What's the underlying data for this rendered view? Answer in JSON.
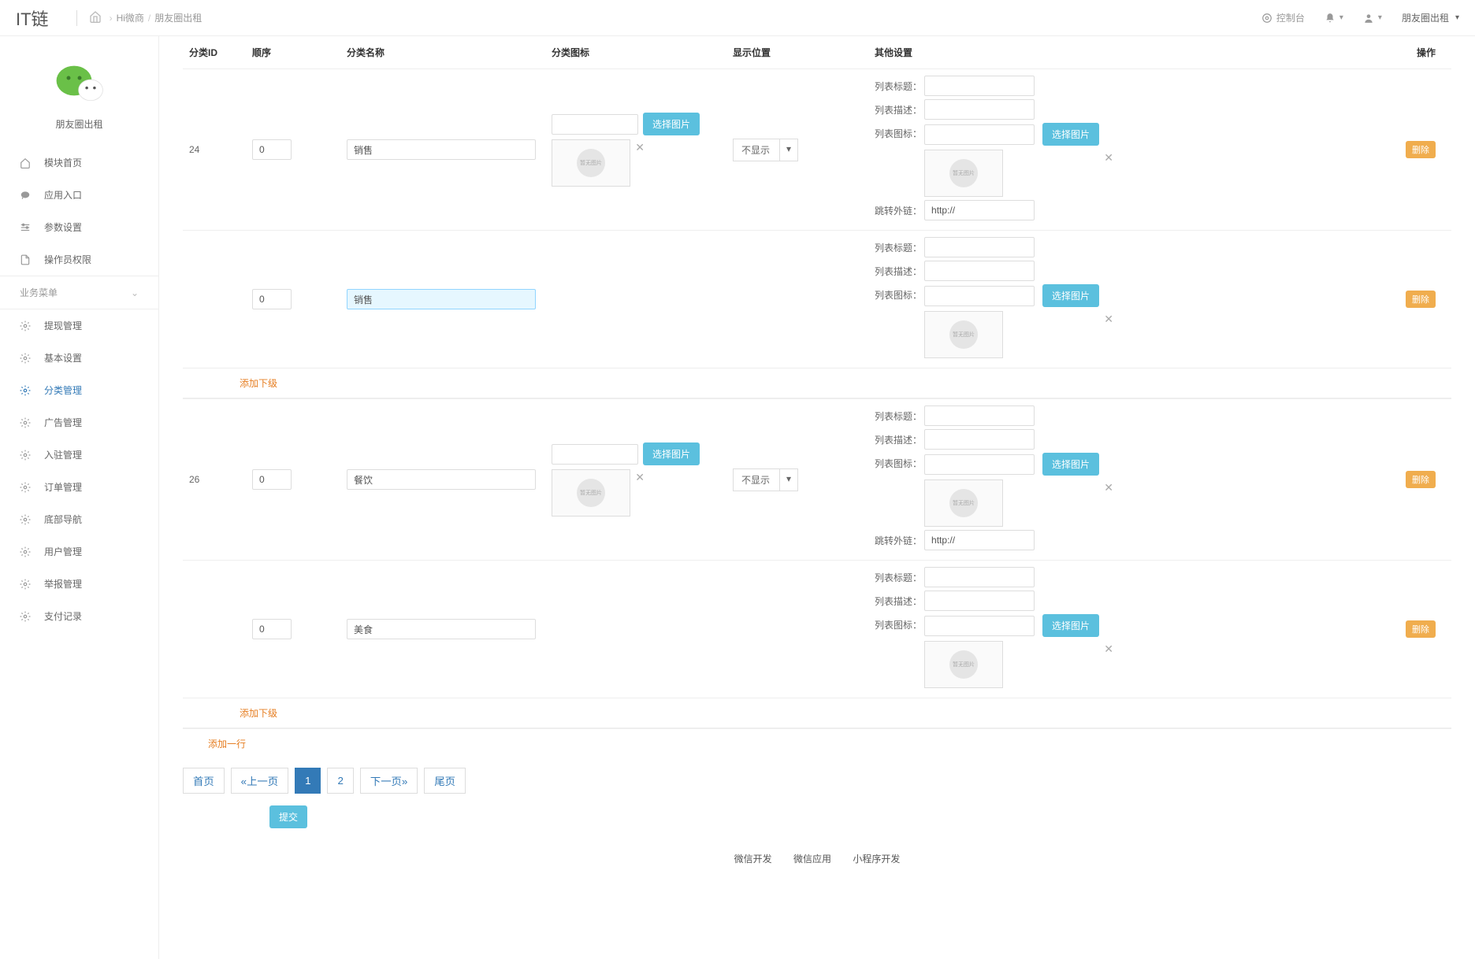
{
  "brand": "IT链",
  "breadcrumb": {
    "item1": "Hi微商",
    "item2": "朋友圈出租"
  },
  "topbar": {
    "console": "控制台",
    "account_selector": "朋友圈出租"
  },
  "sidebar": {
    "title": "朋友圈出租",
    "items_top": [
      {
        "label": "模块首页",
        "icon": "home"
      },
      {
        "label": "应用入口",
        "icon": "comment"
      },
      {
        "label": "参数设置",
        "icon": "settings"
      },
      {
        "label": "操作员权限",
        "icon": "doc"
      }
    ],
    "section_label": "业务菜单",
    "items_biz": [
      {
        "label": "提现管理",
        "icon": "gear"
      },
      {
        "label": "基本设置",
        "icon": "gear"
      },
      {
        "label": "分类管理",
        "icon": "gear",
        "active": true
      },
      {
        "label": "广告管理",
        "icon": "gear"
      },
      {
        "label": "入驻管理",
        "icon": "gear"
      },
      {
        "label": "订单管理",
        "icon": "gear"
      },
      {
        "label": "底部导航",
        "icon": "gear"
      },
      {
        "label": "用户管理",
        "icon": "gear"
      },
      {
        "label": "举报管理",
        "icon": "gear"
      },
      {
        "label": "支付记录",
        "icon": "gear"
      }
    ]
  },
  "table": {
    "headers": {
      "id": "分类ID",
      "sort": "顺序",
      "name": "分类名称",
      "icon": "分类图标",
      "pos": "显示位置",
      "other": "其他设置",
      "op": "操作"
    },
    "labels": {
      "list_title": "列表标题：",
      "list_desc": "列表描述：",
      "list_icon": "列表图标：",
      "jump_link": "跳转外链：",
      "select_image": "选择图片",
      "delete": "删除",
      "no_show": "不显示",
      "placeholder_img": "暂无图片",
      "http_prefix": "http://"
    },
    "rows": [
      {
        "id": "24",
        "sort": "0",
        "name": "销售",
        "pos": "不显示",
        "has_link": true,
        "sub_highlight": false
      },
      {
        "id": "",
        "sort": "0",
        "name": "销售",
        "pos": "",
        "has_link": false,
        "sub_highlight": true
      },
      {
        "id": "26",
        "sort": "0",
        "name": "餐饮",
        "pos": "不显示",
        "has_link": true,
        "sub_highlight": false
      },
      {
        "id": "",
        "sort": "0",
        "name": "美食",
        "pos": "",
        "has_link": false,
        "sub_highlight": false
      }
    ],
    "add_sub_label": "添加下级",
    "add_row_label": "添加一行"
  },
  "pagination": {
    "first": "首页",
    "prev": "«上一页",
    "p1": "1",
    "p2": "2",
    "next": "下一页»",
    "last": "尾页"
  },
  "submit_label": "提交",
  "footer": {
    "l1": "微信开发",
    "l2": "微信应用",
    "l3": "小程序开发"
  }
}
